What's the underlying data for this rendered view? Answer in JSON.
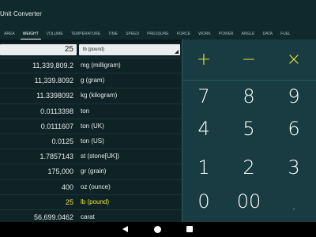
{
  "app": {
    "title": "Unit Converter"
  },
  "tabs": [
    {
      "label": "AREA"
    },
    {
      "label": "WEIGHT",
      "active": true
    },
    {
      "label": "VOLUME"
    },
    {
      "label": "TEMPERATURE"
    },
    {
      "label": "TIME"
    },
    {
      "label": "SPEED"
    },
    {
      "label": "PRESSURE"
    },
    {
      "label": "FORCE"
    },
    {
      "label": "WORK"
    },
    {
      "label": "POWER"
    },
    {
      "label": "ANGLE"
    },
    {
      "label": "DATA"
    },
    {
      "label": "FUEL"
    }
  ],
  "input": {
    "value": "25",
    "unit": "lb (pound)"
  },
  "rows": [
    {
      "value": "11,339,809.2",
      "unit": "mg (milligram)"
    },
    {
      "value": "11,339.8092",
      "unit": "g (gram)"
    },
    {
      "value": "11.3398092",
      "unit": "kg (kilogram)"
    },
    {
      "value": "0.0113398",
      "unit": "ton"
    },
    {
      "value": "0.0111607",
      "unit": "ton (UK)"
    },
    {
      "value": "0.0125",
      "unit": "ton (US)"
    },
    {
      "value": "1.7857143",
      "unit": "st (stone[UK])"
    },
    {
      "value": "175,000",
      "unit": "gr (grain)"
    },
    {
      "value": "400",
      "unit": "oz (ounce)"
    },
    {
      "value": "25",
      "unit": "lb (pound)",
      "highlight": true
    },
    {
      "value": "56,699.0462",
      "unit": "carat"
    }
  ],
  "keypad": {
    "ops": [
      "+",
      "−",
      "×"
    ],
    "digits": [
      "7",
      "8",
      "9",
      "4",
      "5",
      "6",
      "1",
      "2",
      "3",
      "0",
      "00",
      "."
    ]
  },
  "colors": {
    "accent": "#f2e636",
    "keypad_bg": "#183c41",
    "list_bg": "#0f2326",
    "appbar_bg": "#10292d"
  },
  "navbar": {
    "icons": [
      "back-icon",
      "home-icon",
      "recent-icon"
    ]
  }
}
